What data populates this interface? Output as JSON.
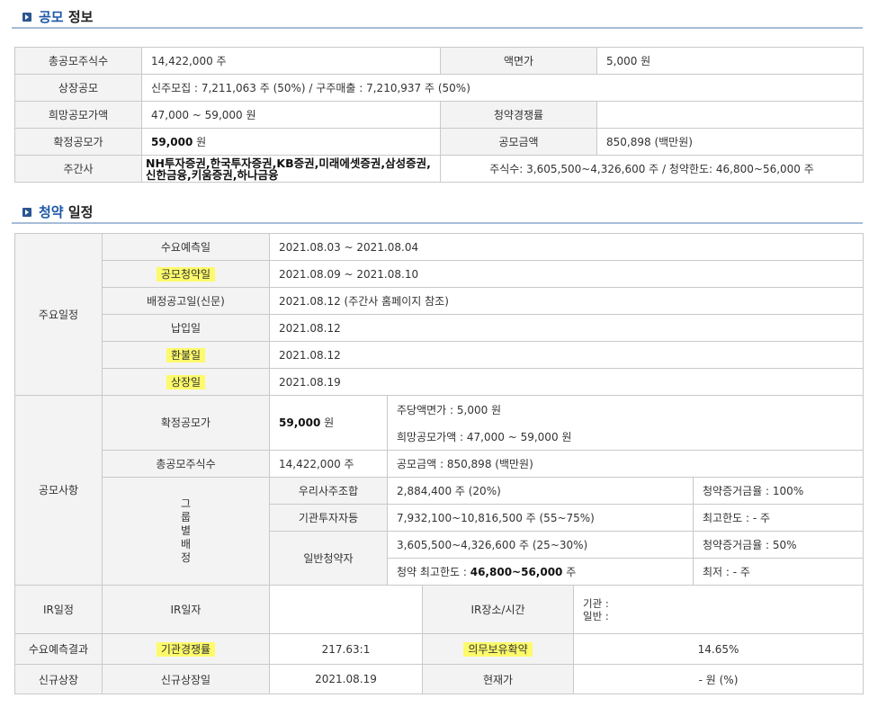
{
  "sections": {
    "offering": {
      "title_main": "공모",
      "title_rest": " 정보"
    },
    "schedule": {
      "title_main": "청약",
      "title_rest": " 일정"
    }
  },
  "offering": {
    "total_shares_label": "총공모주식수",
    "total_shares_value": "14,422,000 주",
    "par_label": "액면가",
    "par_value": "5,000 원",
    "listing_offer_label": "상장공모",
    "listing_offer_value": "신주모집 : 7,211,063 주 (50%)   /   구주매출 : 7,210,937 주 (50%)",
    "hope_price_label": "희망공모가액",
    "hope_price_value": "47,000 ~ 59,000 원",
    "competition_label": "청약경쟁률",
    "competition_value": "",
    "final_price_label": "확정공모가",
    "final_price_amount": "59,000",
    "final_price_unit": " 원",
    "amount_label": "공모금액",
    "amount_value": "850,898 (백만원)",
    "managers_label": "주간사",
    "managers_value": "NH투자증권,한국투자증권,KB증권,미래에셋증권,삼성증권,신한금융,키움증권,하나금융",
    "managers_shares": "주식수: 3,605,500~4,326,600 주   /   청약한도: 46,800~56,000 주"
  },
  "schedule": {
    "main_label": "주요일정",
    "rows": [
      {
        "label": "수요예측일",
        "value": "2021.08.03   ~   2021.08.04"
      },
      {
        "label": "공모청약일",
        "value": "2021.08.09   ~   2021.08.10"
      },
      {
        "label": "배정공고일(신문)",
        "value": "2021.08.12 (주간사 홈페이지 참조)"
      },
      {
        "label": "납입일",
        "value": "2021.08.12"
      },
      {
        "label": "환불일",
        "value": "2021.08.12"
      },
      {
        "label": "상장일",
        "value": "2021.08.19"
      }
    ],
    "offering_items_label": "공모사항",
    "final_price_label": "확정공모가",
    "final_price_amount": "59,000",
    "final_price_unit": " 원",
    "par_value": "주당액면가 :  5,000 원",
    "hope_price": "희망공모가액 :  47,000 ~ 59,000 원",
    "total_shares_label": "총공모주식수",
    "total_shares_value": "14,422,000 주",
    "amount_value": "공모금액 : 850,898 (백만원)",
    "group_label": "그룹별배정",
    "groups": [
      {
        "name": "우리사주조합",
        "shares": "2,884,400 주  (20%)",
        "note": "청약증거금율 : 100%"
      },
      {
        "name": "기관투자자등",
        "shares": "7,932,100~10,816,500 주  (55~75%)",
        "note": "최고한도 :  - 주"
      },
      {
        "name": "일반청약자",
        "shares": "3,605,500~4,326,600 주  (25~30%)",
        "note": "청약증거금율 : 50%"
      }
    ],
    "retail_limit_label": "청약 최고한도 :  ",
    "retail_limit_value": "46,800~56,000",
    "retail_limit_unit": " 주",
    "retail_min": "최저 :  - 주",
    "ir_label": "IR일정",
    "ir_date_label": "IR일자",
    "ir_date_value": "",
    "ir_place_label": "IR장소/시간",
    "ir_place_inst": "기관 :",
    "ir_place_retail": "일반 :",
    "demand_label": "수요예측결과",
    "inst_comp_label": "기관경쟁률",
    "inst_comp_value": "217.63:1",
    "lockup_label": "의무보유확약",
    "lockup_value": "14.65%",
    "new_listing_label": "신규상장",
    "new_listing_date_label": "신규상장일",
    "new_listing_date_value": "2021.08.19",
    "current_price_label": "현재가",
    "current_price_value": "- 원 (%)"
  }
}
